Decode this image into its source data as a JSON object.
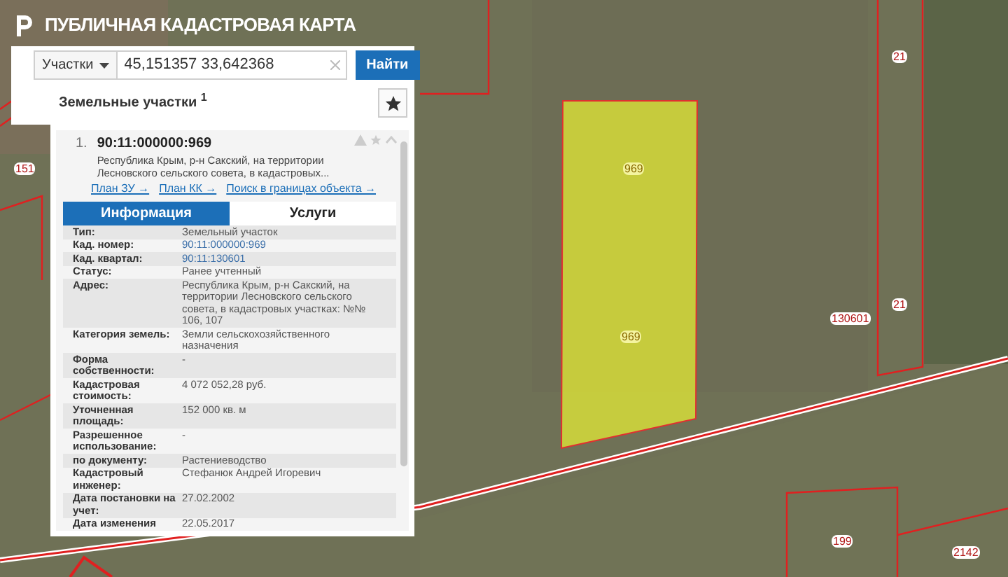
{
  "app_title": "ПУБЛИЧНАЯ КАДАСТРОВАЯ КАРТА",
  "search": {
    "category": "Участки",
    "value": "45,151357 33,642368",
    "button": "Найти"
  },
  "results": {
    "title": "Земельные участки",
    "count": "1",
    "items": [
      {
        "number": "1.",
        "cad_number": "90:11:000000:969",
        "address": "Республика Крым, р-н Сакский, на территории Лесновского сельского совета, в кадастровых...",
        "links": [
          "План ЗУ →",
          "План КК →",
          "Поиск в границах объекта →"
        ]
      }
    ]
  },
  "tabs": [
    {
      "label": "Информация",
      "selected": true
    },
    {
      "label": "Услуги",
      "selected": false
    }
  ],
  "info_rows": [
    {
      "label": "Тип:",
      "value": "Земельный участок",
      "link": false
    },
    {
      "label": "Кад. номер:",
      "value": "90:11:000000:969",
      "link": true
    },
    {
      "label": "Кад. квартал:",
      "value": "90:11:130601",
      "link": true
    },
    {
      "label": "Статус:",
      "value": "Ранее учтенный",
      "link": false
    },
    {
      "label": "Адрес:",
      "value": "Республика Крым, р-н Сакский, на территории Лесновского сельского совета, в кадастровых участках: №№ 106, 107",
      "link": false
    },
    {
      "label": "Категория земель:",
      "value": "Земли сельскохозяйственного назначения",
      "link": false
    },
    {
      "label": "Форма собственности:",
      "value": "-",
      "link": false
    },
    {
      "label": "Кадастровая стоимость:",
      "value": "4 072 052,28 руб.",
      "link": false
    },
    {
      "label": "Уточненная площадь:",
      "value": "152 000 кв. м",
      "link": false
    },
    {
      "label": "Разрешенное использование:",
      "value": "-",
      "link": false
    },
    {
      "label": "по документу:",
      "value": "Растениеводство",
      "link": false
    },
    {
      "label": "Кадастровый инженер:",
      "value": "Стефанюк Андрей Игоревич",
      "link": false
    },
    {
      "label": "Дата постановки на учет:",
      "value": "27.02.2002",
      "link": false
    },
    {
      "label": "Дата изменения",
      "value": "22.05.2017",
      "link": false
    }
  ],
  "map_labels": [
    {
      "text": "969",
      "kind": "selected"
    },
    {
      "text": "969",
      "kind": "selected"
    },
    {
      "text": "21",
      "kind": "parcel"
    },
    {
      "text": "21",
      "kind": "parcel"
    },
    {
      "text": "130601",
      "kind": "parcel"
    },
    {
      "text": "199",
      "kind": "parcel"
    },
    {
      "text": "2142",
      "kind": "parcel"
    },
    {
      "text": "151",
      "kind": "parcel"
    }
  ]
}
